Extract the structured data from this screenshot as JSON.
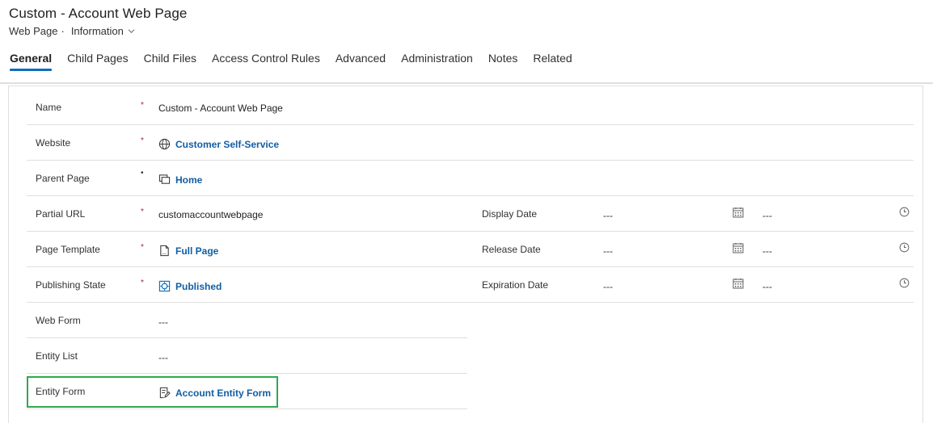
{
  "header": {
    "title": "Custom - Account Web Page",
    "entity": "Web Page",
    "separator": "·",
    "form_name": "Information"
  },
  "tabs": [
    {
      "label": "General",
      "active": true
    },
    {
      "label": "Child Pages"
    },
    {
      "label": "Child Files"
    },
    {
      "label": "Access Control Rules"
    },
    {
      "label": "Advanced"
    },
    {
      "label": "Administration"
    },
    {
      "label": "Notes"
    },
    {
      "label": "Related"
    }
  ],
  "fields": {
    "name": {
      "label": "Name",
      "required": "*",
      "value": "Custom - Account Web Page"
    },
    "website": {
      "label": "Website",
      "required": "*",
      "value": "Customer Self-Service",
      "icon": "globe-icon"
    },
    "parent_page": {
      "label": "Parent Page",
      "required": "•",
      "value": "Home",
      "icon": "pages-icon"
    },
    "partial_url": {
      "label": "Partial URL",
      "required": "*",
      "value": "customaccountwebpage"
    },
    "page_template": {
      "label": "Page Template",
      "required": "*",
      "value": "Full Page",
      "icon": "page-template-icon"
    },
    "publishing_state": {
      "label": "Publishing State",
      "required": "*",
      "value": "Published",
      "icon": "publishing-state-icon"
    },
    "web_form": {
      "label": "Web Form",
      "value": "---"
    },
    "entity_list": {
      "label": "Entity List",
      "value": "---"
    },
    "entity_form": {
      "label": "Entity Form",
      "value": "Account Entity Form",
      "icon": "entity-form-icon"
    },
    "display_date": {
      "label": "Display Date",
      "date": "---",
      "time": "---"
    },
    "release_date": {
      "label": "Release Date",
      "date": "---",
      "time": "---"
    },
    "expiration_date": {
      "label": "Expiration Date",
      "date": "---",
      "time": "---"
    }
  },
  "colors": {
    "accent": "#0f6cbd",
    "link": "#115ea3",
    "required": "#a4262c",
    "highlight": "#2fa84f"
  }
}
